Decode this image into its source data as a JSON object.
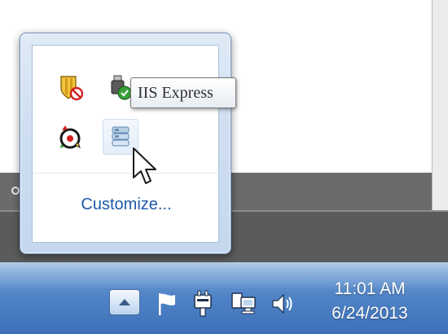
{
  "tooltip": {
    "text": "IIS Express"
  },
  "flyout": {
    "customize_label": "Customize...",
    "icons": [
      {
        "name": "shield-blocked-icon"
      },
      {
        "name": "usb-device-icon"
      },
      {
        "name": "outlook-icon"
      },
      {
        "name": "antivirus-monitor-icon"
      },
      {
        "name": "iis-express-icon"
      }
    ]
  },
  "taskbar": {
    "tray_icons": [
      "show-hidden-icons-icon",
      "action-center-flag-icon",
      "power-plug-icon",
      "network-icon",
      "volume-icon"
    ],
    "clock": {
      "time": "11:01 AM",
      "date": "6/24/2013"
    }
  },
  "colors": {
    "taskbar": "#4f82c6",
    "customize_link": "#1e5aa8"
  }
}
